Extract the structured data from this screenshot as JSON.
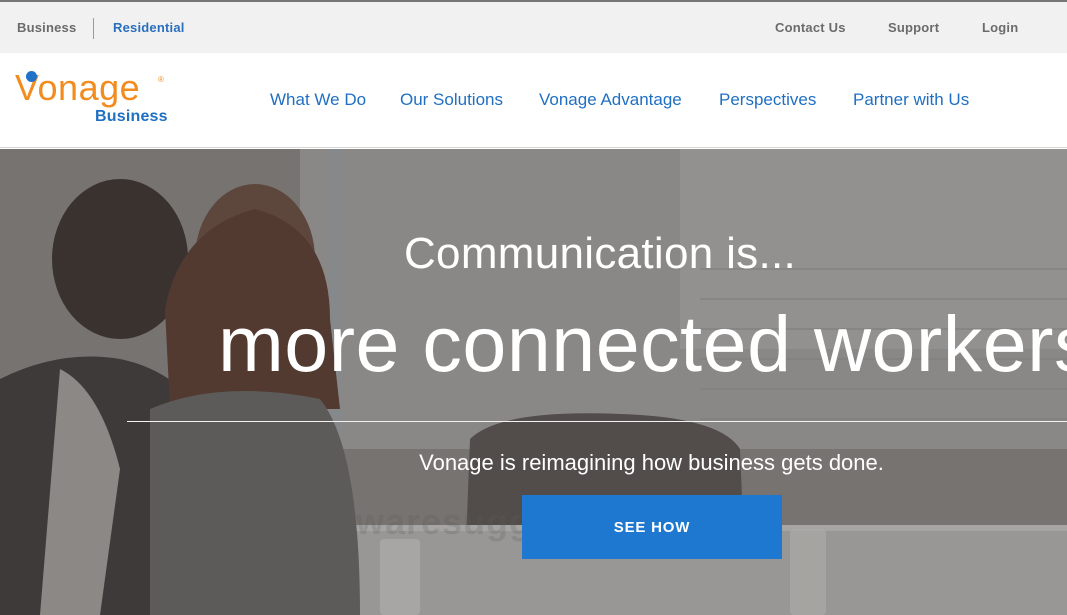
{
  "utility_bar": {
    "business": "Business",
    "residential": "Residential",
    "contact": "Contact Us",
    "support": "Support",
    "login": "Login"
  },
  "logo": {
    "word": "Vonage",
    "registered": "®",
    "sub": "Business"
  },
  "nav": {
    "items": [
      {
        "label": "What We Do"
      },
      {
        "label": "Our Solutions"
      },
      {
        "label": "Vonage Advantage"
      },
      {
        "label": "Perspectives"
      },
      {
        "label": "Partner with Us"
      }
    ]
  },
  "hero": {
    "heading": "Communication is...",
    "title": "more connected workers.",
    "subtitle": "Vonage is reimagining how business gets done.",
    "cta": "SEE HOW",
    "watermark": "ftwaresuggest.com"
  },
  "colors": {
    "brand_blue": "#1f6fc3",
    "brand_orange": "#f28c1f",
    "cta_blue": "#1e78cf"
  }
}
